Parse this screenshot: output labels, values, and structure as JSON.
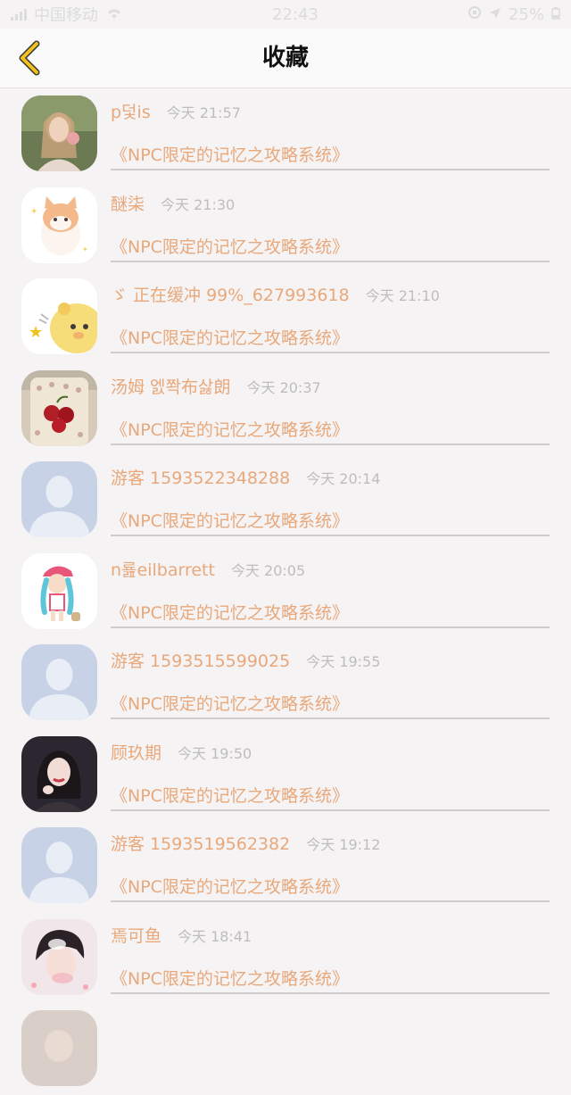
{
  "status_bar": {
    "carrier": "中国移动",
    "time": "22:43",
    "battery": "25%",
    "wifi_icon": "wifi-icon",
    "battery_icon": "battery-icon"
  },
  "nav": {
    "back_icon": "chevron-left-icon",
    "title": "收藏"
  },
  "items": [
    {
      "username": "p덫is",
      "time": "今天 21:57",
      "book": "《NPC限定的记忆之攻略系统》",
      "avatar": "photo"
    },
    {
      "username": "醚柒",
      "time": "今天 21:30",
      "book": "《NPC限定的记忆之攻略系统》",
      "avatar": "cat-cartoon"
    },
    {
      "username": "ゞ 正在缓冲 99%_627993618",
      "time": "今天 21:10",
      "book": "《NPC限定的记忆之攻略系统》",
      "avatar": "bear-cartoon"
    },
    {
      "username": "汤姆 엜쫙布삻朗",
      "time": "今天 20:37",
      "book": "《NPC限定的记忆之攻略系统》",
      "avatar": "cherry-case"
    },
    {
      "username": "游客 1593522348288",
      "time": "今天 20:14",
      "book": "《NPC限定的记忆之攻略系统》",
      "avatar": "default"
    },
    {
      "username": "n룚eilbarrett",
      "time": "今天 20:05",
      "book": "《NPC限定的记忆之攻略系统》",
      "avatar": "girl-cartoon"
    },
    {
      "username": "游客 1593515599025",
      "time": "今天 19:55",
      "book": "《NPC限定的记忆之攻略系统》",
      "avatar": "default"
    },
    {
      "username": "顾玖期",
      "time": "今天 19:50",
      "book": "《NPC限定的记忆之攻略系统》",
      "avatar": "photo-dark"
    },
    {
      "username": "游客 1593519562382",
      "time": "今天 19:12",
      "book": "《NPC限定的记忆之攻略系统》",
      "avatar": "default"
    },
    {
      "username": "焉可鱼",
      "time": "今天 18:41",
      "book": "《NPC限定的记忆之攻略系统》",
      "avatar": "photo-boy"
    }
  ],
  "colors": {
    "username": "#e8a87a",
    "book_title": "#e8a87a",
    "time": "#bdbdbd",
    "back_arrow": "#f2c21b",
    "divider": "#cfcccf"
  }
}
